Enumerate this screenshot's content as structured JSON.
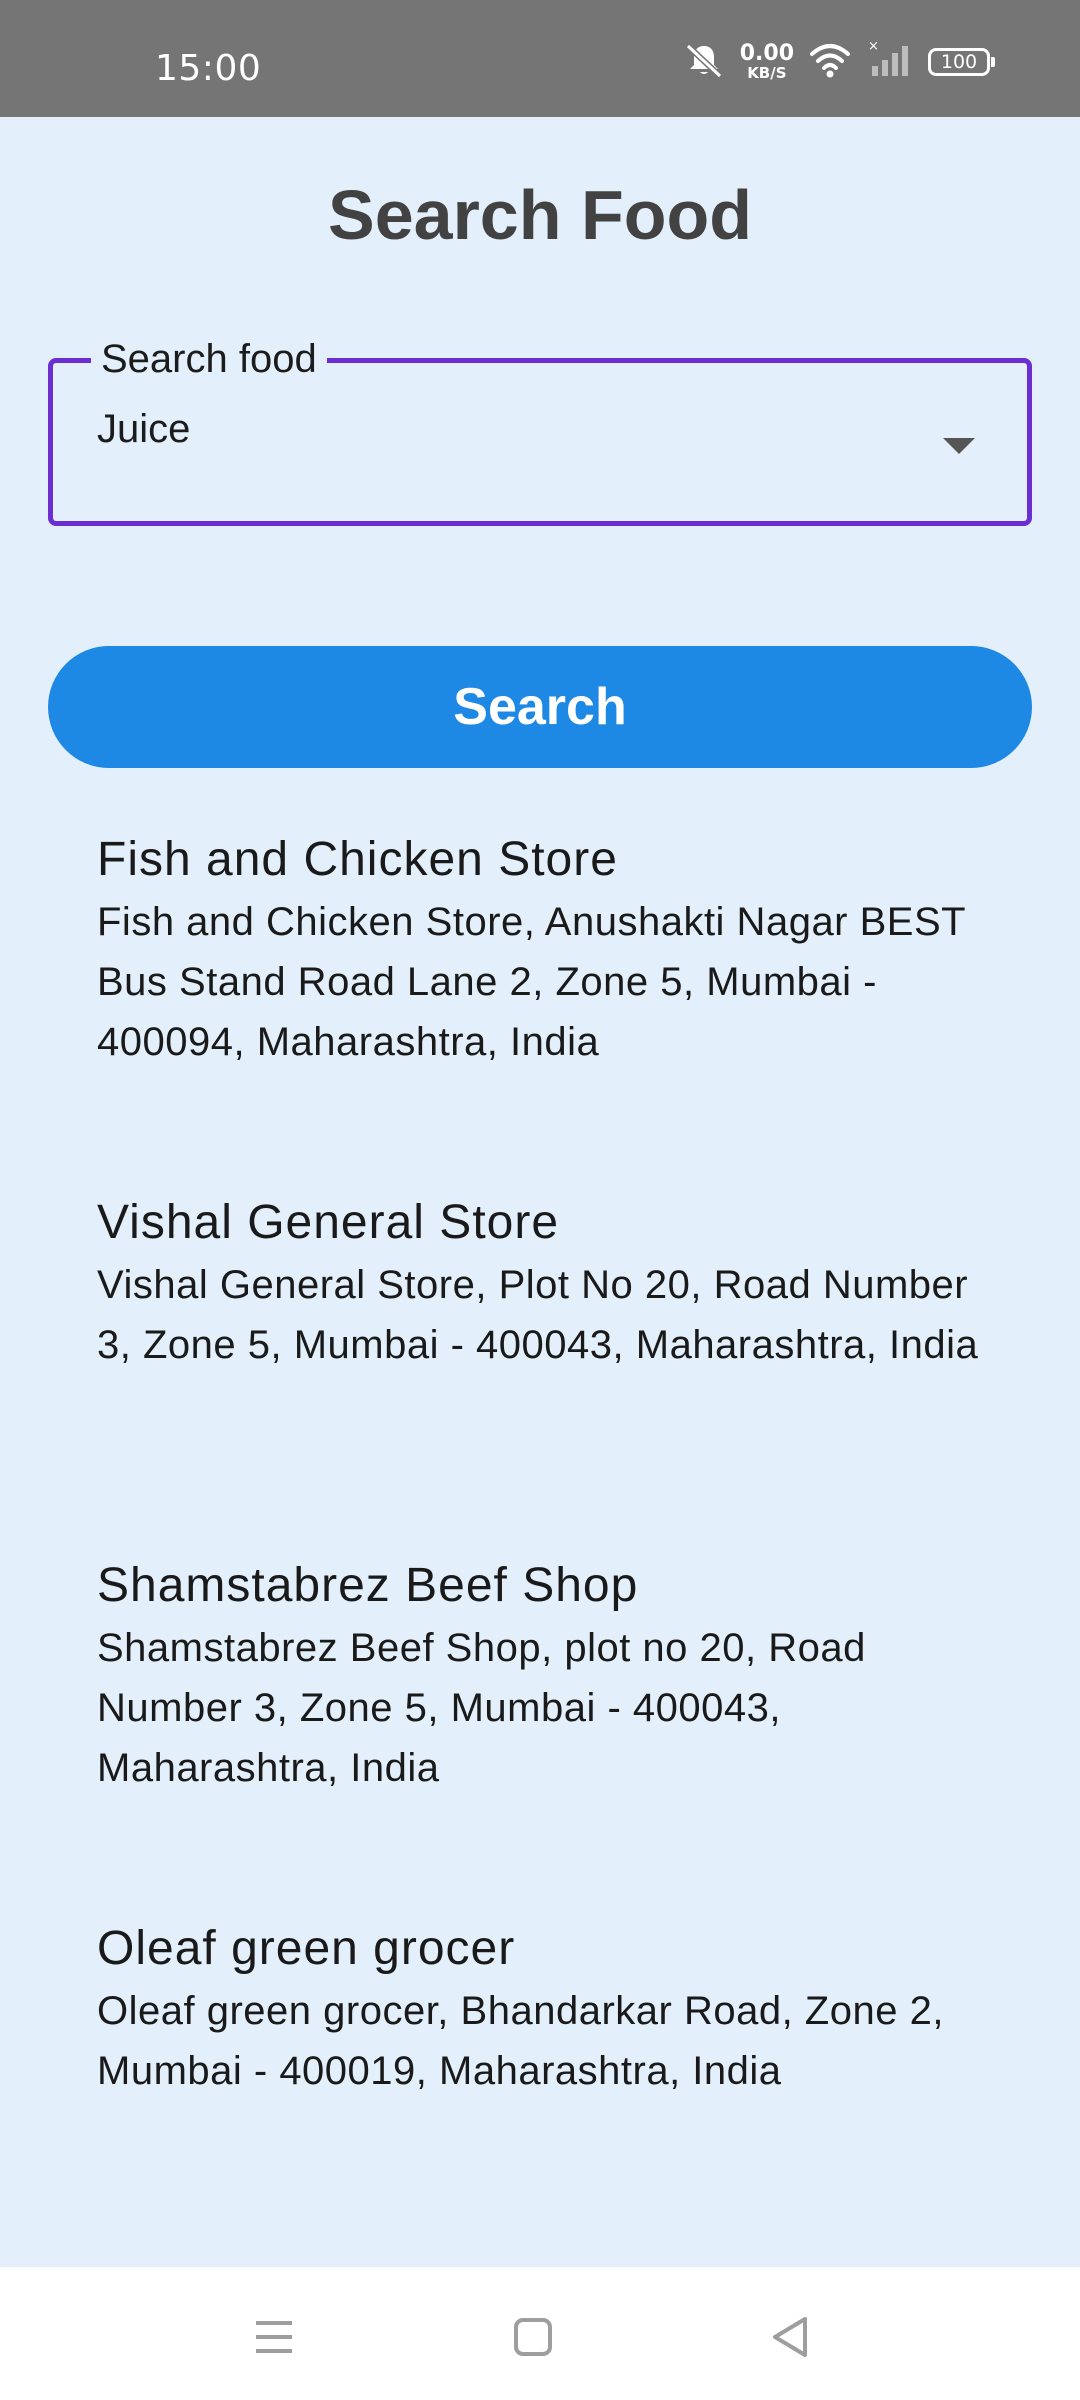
{
  "status_bar": {
    "time": "15:00",
    "net_speed_value": "0.00",
    "net_speed_unit": "KB/S",
    "battery": "100",
    "icons": [
      "mute-icon",
      "wifi-icon",
      "signal-icon",
      "battery-icon"
    ]
  },
  "page": {
    "title": "Search Food"
  },
  "search": {
    "label": "Search food",
    "value": "Juice",
    "button_label": "Search"
  },
  "results": [
    {
      "name": "Fish and Chicken Store",
      "address": "Fish and Chicken Store, Anushakti Nagar BEST Bus Stand Road Lane 2, Zone 5, Mumbai - 400094, Maharashtra, India"
    },
    {
      "name": "Vishal General Store",
      "address": "Vishal General Store, Plot No 20, Road Number 3, Zone 5, Mumbai - 400043, Maharashtra, India"
    },
    {
      "name": "Shamstabrez Beef Shop",
      "address": "Shamstabrez Beef Shop, plot no 20, Road Number 3, Zone 5, Mumbai - 400043, Maharashtra, India"
    },
    {
      "name": "Oleaf green grocer",
      "address": "Oleaf green grocer, Bhandarkar Road, Zone 2, Mumbai - 400019, Maharashtra, India"
    }
  ],
  "colors": {
    "background": "#e3f0fc",
    "status_bar": "#757575",
    "accent_border": "#6b2fd1",
    "button": "#1e88e5"
  },
  "nav_bar": {
    "icons": [
      "menu-icon",
      "home-icon",
      "back-icon"
    ]
  }
}
